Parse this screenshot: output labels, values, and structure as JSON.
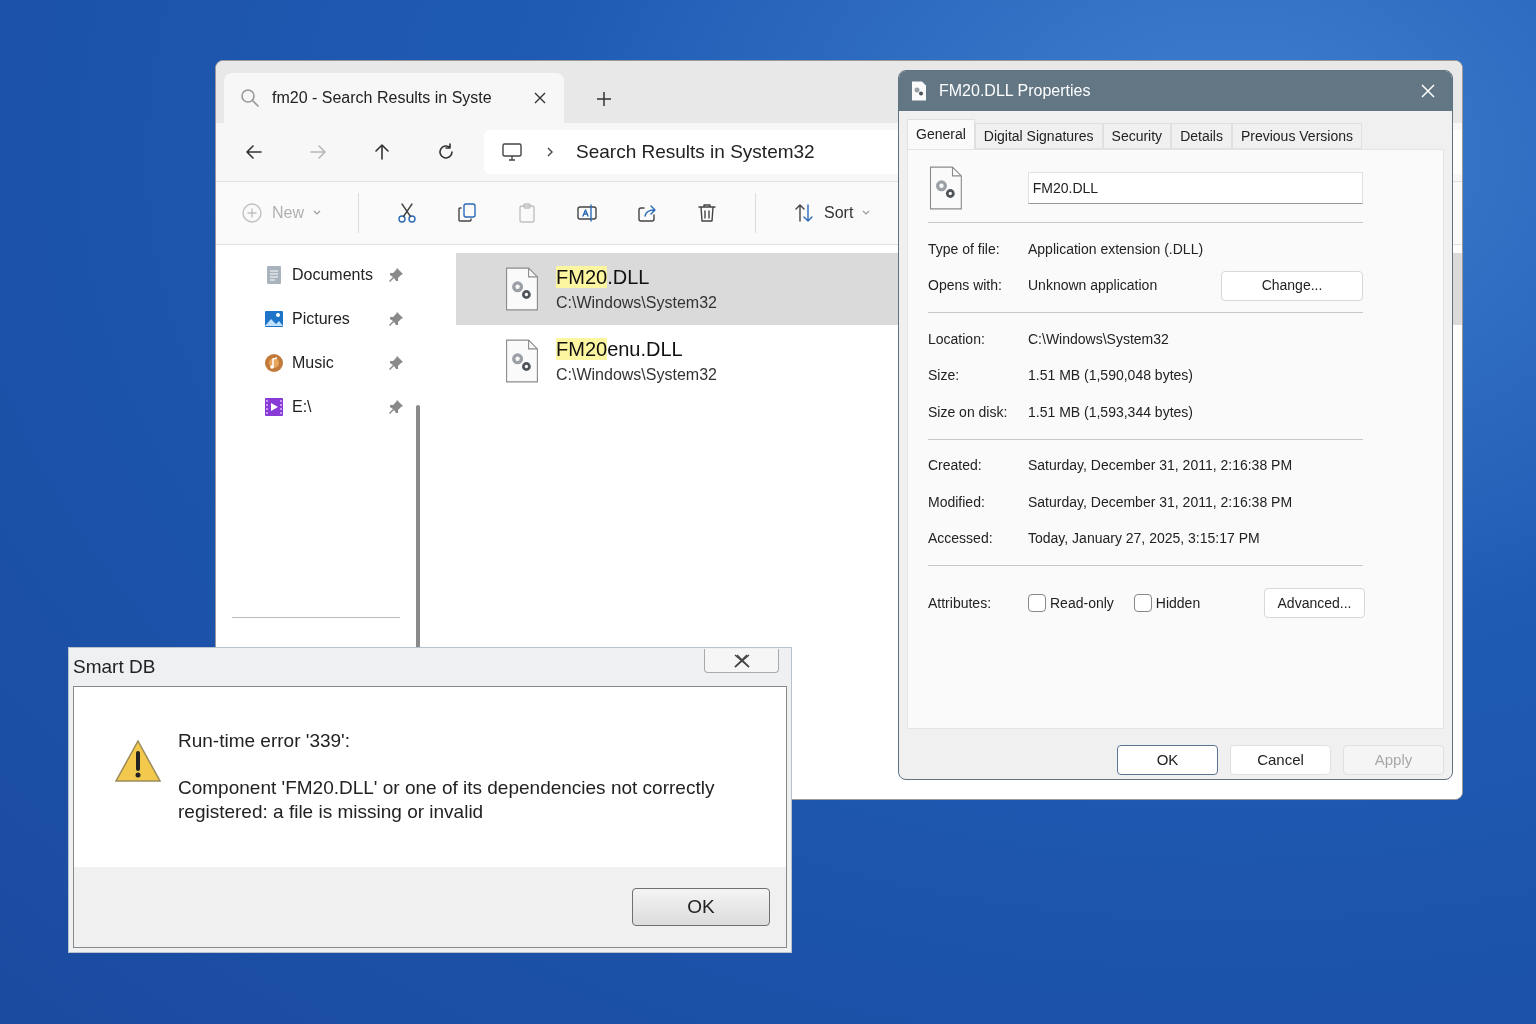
{
  "explorer": {
    "tab": {
      "title": "fm20 - Search Results in Syste"
    },
    "nav": [
      {
        "kind": "back",
        "disabled": false
      },
      {
        "kind": "forward",
        "disabled": true
      },
      {
        "kind": "up",
        "disabled": false
      },
      {
        "kind": "refresh",
        "disabled": false
      }
    ],
    "address": "Search Results in System32",
    "toolbar": [
      {
        "kind": "new",
        "label": "New",
        "disabled": true
      },
      {
        "kind": "cut",
        "disabled": false
      },
      {
        "kind": "copy",
        "disabled": false
      },
      {
        "kind": "paste",
        "disabled": true
      },
      {
        "kind": "rename",
        "disabled": false
      },
      {
        "kind": "share",
        "disabled": false
      },
      {
        "kind": "delete",
        "disabled": false
      },
      {
        "kind": "sort",
        "label": "Sort",
        "disabled": false
      }
    ],
    "sidebar": {
      "items": [
        {
          "kind": "documents",
          "label": "Documents"
        },
        {
          "kind": "pictures",
          "label": "Pictures"
        },
        {
          "kind": "music",
          "label": "Music"
        },
        {
          "kind": "drive",
          "label": "E:\\"
        }
      ]
    },
    "results": [
      {
        "match": "FM20",
        "rest": ".DLL",
        "path": "C:\\Windows\\System32",
        "selected": true
      },
      {
        "match": "FM20",
        "rest": "enu.DLL",
        "path": "C:\\Windows\\System32",
        "selected": false
      }
    ]
  },
  "properties": {
    "title": "FM20.DLL Properties",
    "tabs": [
      {
        "label": "General",
        "selected": true
      },
      {
        "label": "Digital Signatures",
        "selected": false
      },
      {
        "label": "Security",
        "selected": false
      },
      {
        "label": "Details",
        "selected": false
      },
      {
        "label": "Previous Versions",
        "selected": false
      }
    ],
    "filename": "FM20.DLL",
    "groups": [
      [
        {
          "label": "Type of file:",
          "value": "Application extension (.DLL)"
        },
        {
          "label": "Opens with:",
          "value": "Unknown application",
          "button": "Change..."
        }
      ],
      [
        {
          "label": "Location:",
          "value": "C:\\Windows\\System32"
        },
        {
          "label": "Size:",
          "value": "1.51 MB (1,590,048 bytes)"
        },
        {
          "label": "Size on disk:",
          "value": "1.51 MB (1,593,344 bytes)"
        }
      ],
      [
        {
          "label": "Created:",
          "value": "Saturday, December 31, 2011, 2:16:38 PM"
        },
        {
          "label": "Modified:",
          "value": "Saturday, December 31, 2011, 2:16:38 PM"
        },
        {
          "label": "Accessed:",
          "value": "Today, January 27, 2025, 3:15:17 PM"
        }
      ]
    ],
    "attributes": {
      "label": "Attributes:",
      "checkboxes": [
        {
          "label": "Read-only",
          "checked": false
        },
        {
          "label": "Hidden",
          "checked": false
        }
      ],
      "button": "Advanced..."
    },
    "buttons": [
      {
        "label": "OK",
        "disabled": false,
        "default": true
      },
      {
        "label": "Cancel",
        "disabled": false,
        "default": false
      },
      {
        "label": "Apply",
        "disabled": true,
        "default": false
      }
    ]
  },
  "error": {
    "title": "Smart DB",
    "heading": "Run-time error '339':",
    "message": "Component 'FM20.DLL' or one of its dependencies not correctly registered: a file is missing or invalid",
    "button": "OK"
  }
}
